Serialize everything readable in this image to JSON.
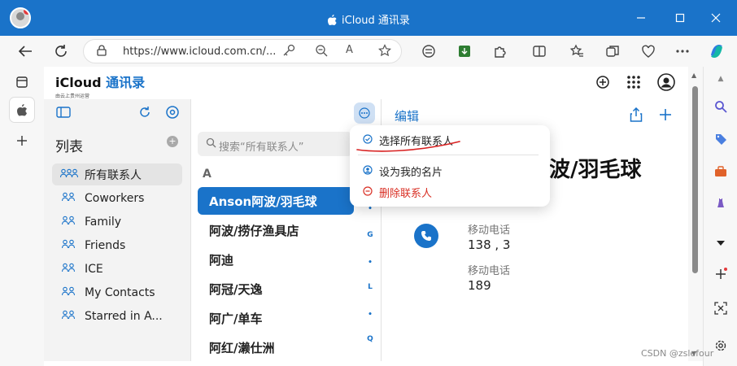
{
  "window": {
    "title": "iCloud 通讯录",
    "apple_icon": "apple-icon",
    "minimize_icon": "minimize-icon",
    "maximize_icon": "maximize-icon",
    "close_icon": "close-icon"
  },
  "browser": {
    "url": "https://www.icloud.com.cn/...",
    "back_icon": "back-icon",
    "refresh_icon": "refresh-icon"
  },
  "app": {
    "brand": "iCloud",
    "brand_accent": "通讯录",
    "brand_sub": "由云上贵州运营"
  },
  "sidebar": {
    "title": "列表",
    "items": [
      {
        "label": "所有联系人",
        "active": true
      },
      {
        "label": "Coworkers"
      },
      {
        "label": "Family"
      },
      {
        "label": "Friends"
      },
      {
        "label": "ICE"
      },
      {
        "label": "My Contacts"
      },
      {
        "label": "Starred in A..."
      }
    ]
  },
  "list": {
    "search_placeholder": "搜索“所有联系人”",
    "section": "A",
    "contacts": [
      {
        "name": "Anson阿波/羽毛球",
        "selected": true
      },
      {
        "name": "阿波/捞仔渔具店"
      },
      {
        "name": "阿迪"
      },
      {
        "name": "阿冠/天逸"
      },
      {
        "name": "阿广/单车"
      },
      {
        "name": "阿红/濑仕洲"
      }
    ],
    "index": [
      "•",
      "G",
      "•",
      "L",
      "•",
      "Q"
    ]
  },
  "detail": {
    "edit_label": "编辑",
    "name": "波/羽毛球",
    "phones": [
      {
        "label": "移动电话",
        "value": "138 ,           3"
      },
      {
        "label": "移动电话",
        "value": "189"
      }
    ]
  },
  "popover": {
    "items": [
      {
        "label": "选择所有联系人",
        "icon": "check-circle-icon",
        "color": "#222222"
      },
      {
        "label": "设为我的名片",
        "icon": "person-circle-icon",
        "color": "#222222"
      },
      {
        "label": "删除联系人",
        "icon": "minus-circle-icon",
        "color": "#d93025"
      }
    ]
  },
  "watermark": "CSDN @zslefour",
  "colors": {
    "accent": "#1a73c9",
    "titlebar": "#1a73c9",
    "danger": "#d93025"
  }
}
